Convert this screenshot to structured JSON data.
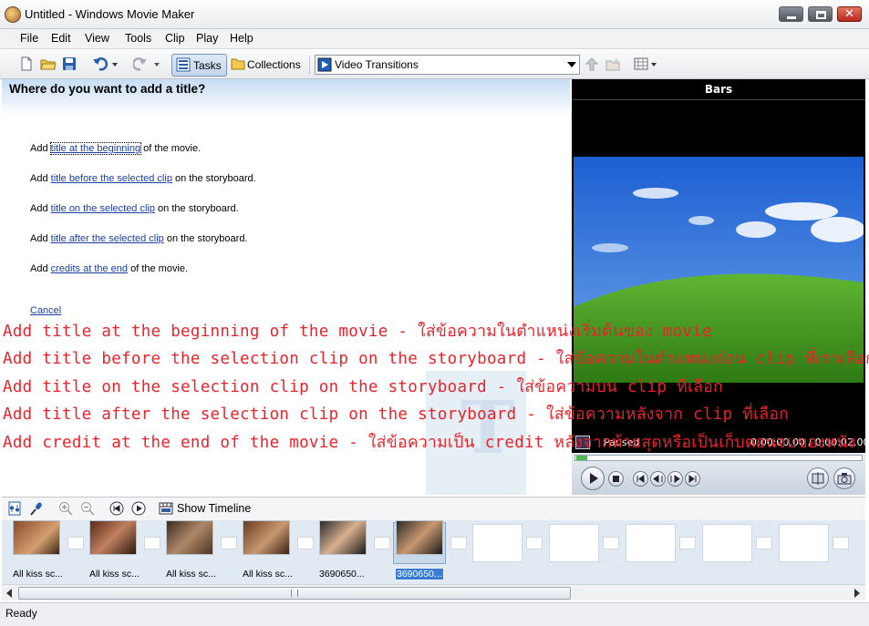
{
  "window": {
    "title": "Untitled - Windows Movie Maker"
  },
  "menu": [
    "File",
    "Edit",
    "View",
    "Tools",
    "Clip",
    "Play",
    "Help"
  ],
  "toolbar": {
    "tasks_label": "Tasks",
    "collections_label": "Collections",
    "collection_value": "Video Transitions"
  },
  "tasks": {
    "heading": "Where do you want to add a title?",
    "options": [
      {
        "prefix": "Add ",
        "link": "title at the beginning",
        "suffix": " of the movie."
      },
      {
        "prefix": "Add ",
        "link": "title before the selected clip",
        "suffix": " on the storyboard."
      },
      {
        "prefix": "Add ",
        "link": "title on the selected clip",
        "suffix": " on the storyboard."
      },
      {
        "prefix": "Add ",
        "link": "title after the selected clip",
        "suffix": " on the storyboard."
      },
      {
        "prefix": "Add ",
        "link": "credits at the end",
        "suffix": " of the movie."
      }
    ],
    "cancel": "Cancel"
  },
  "annotations": [
    "Add title at the beginning of the movie - ใส่ข้อความในตำแหน่งเริ่มต้นของ movie",
    "Add title before the selection clip on the storyboard - ใส่ข้อความในตำแหน่งก่อน clip ที่เราเลือก",
    "Add title on the selection clip on the storyboard - ใส่ข้อความบน clip ที่เลือก",
    "Add title after the selection clip on the storyboard - ใส่ข้อความหลังจาก clip ที่เลือก",
    "Add credit at the end of the movie - ใส่ข้อความเป็น credit หลังจากท้ายสุดหรือเป็นเก็บตอนจบของหนัง"
  ],
  "preview": {
    "title": "Bars",
    "status": "Paused",
    "time": "0:00:00.00 / 0:00:02.00"
  },
  "storyboard": {
    "show_timeline_label": "Show Timeline",
    "clips": [
      "All kiss sc...",
      "All kiss sc...",
      "All kiss sc...",
      "All kiss sc...",
      "3690650...",
      "3690650..."
    ]
  },
  "status": {
    "text": "Ready"
  },
  "colors": {
    "annotation": "#e8242b",
    "link": "#1a3ea5",
    "selection": "#3a7bd5"
  }
}
